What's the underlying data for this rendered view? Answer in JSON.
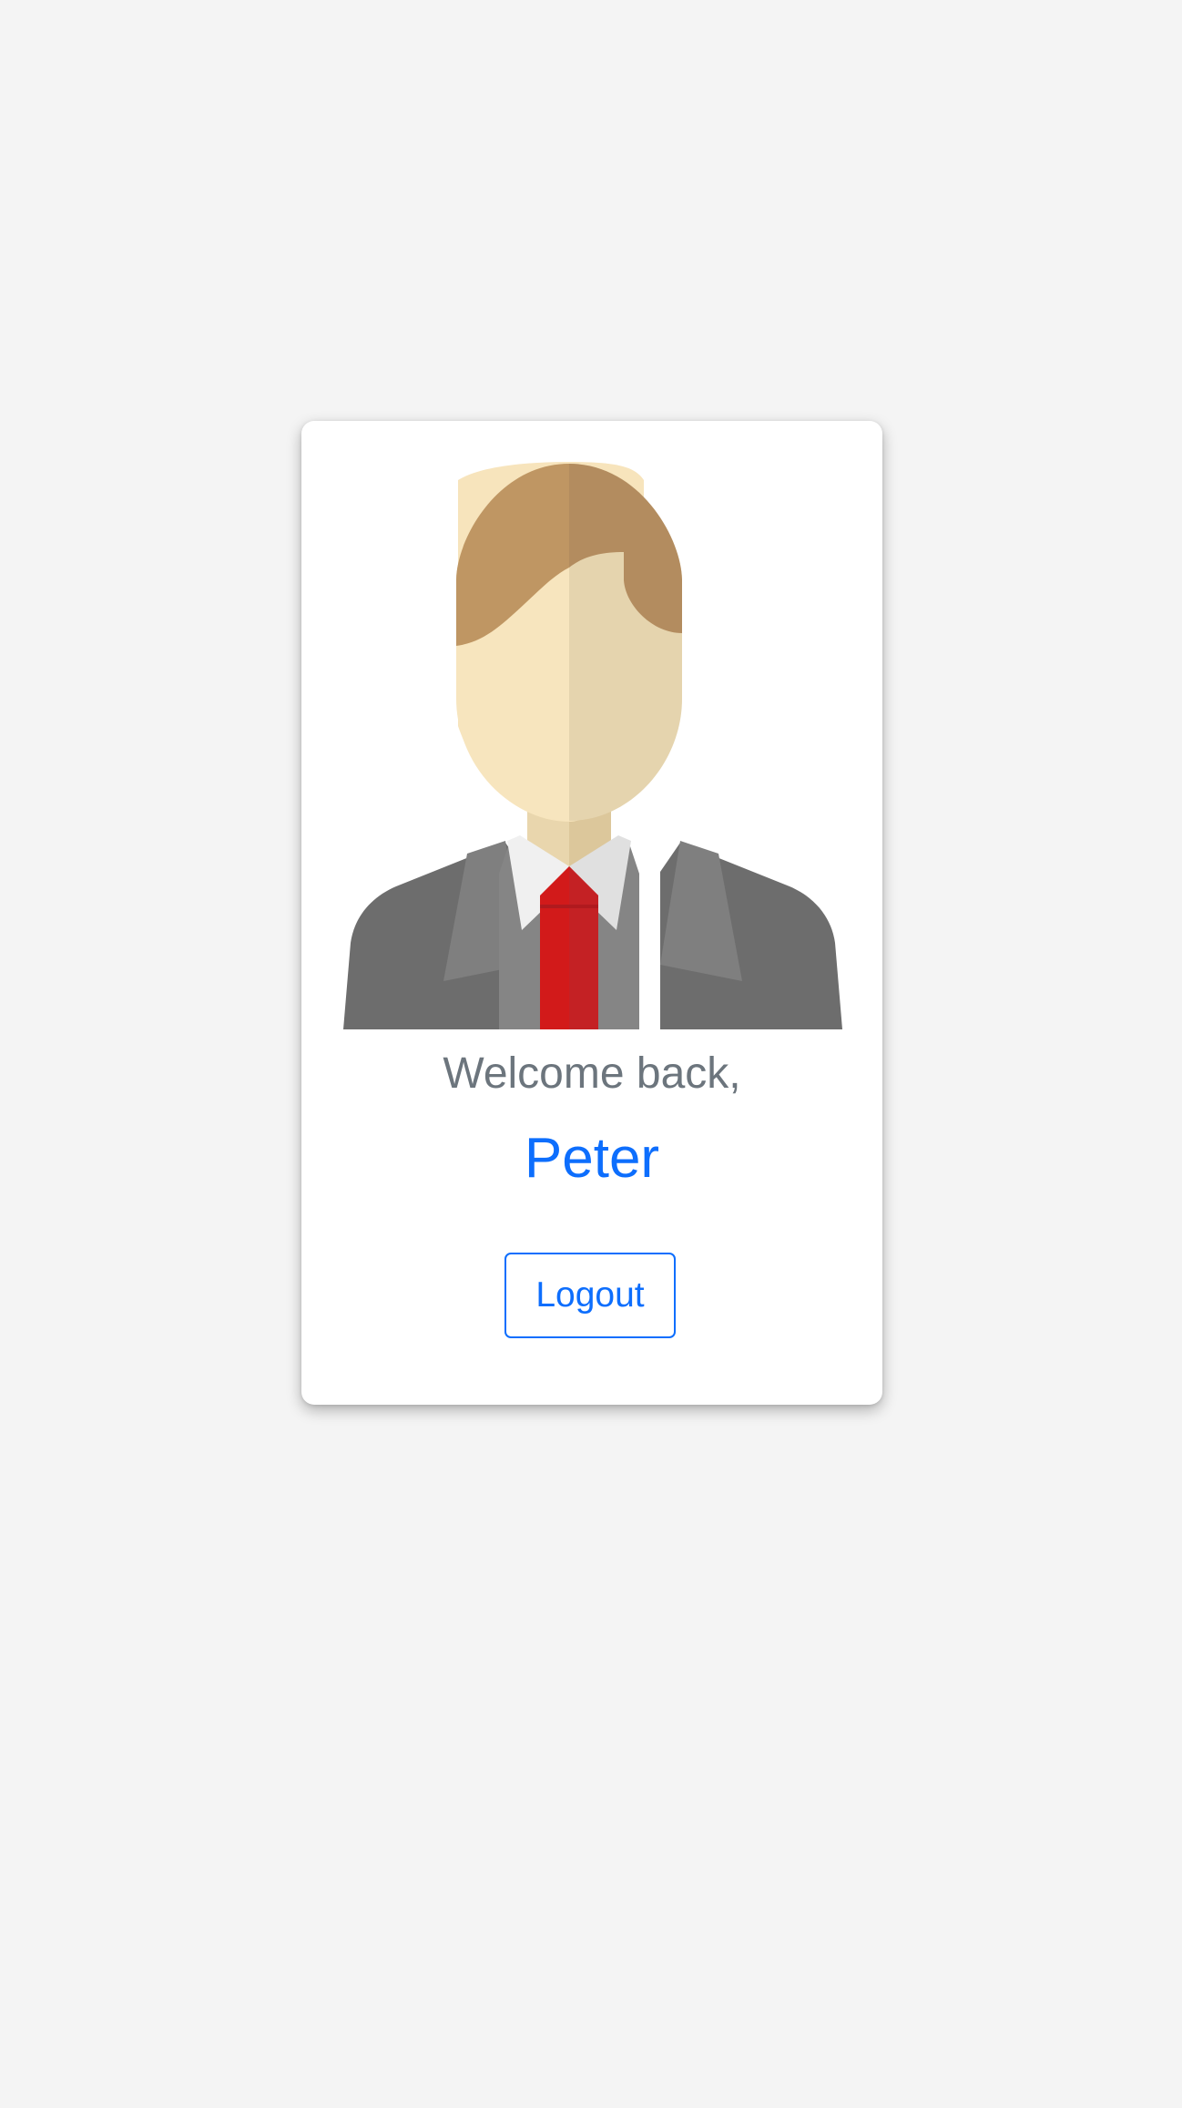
{
  "greeting": "Welcome back,",
  "user": {
    "name": "Peter"
  },
  "actions": {
    "logout_label": "Logout"
  },
  "avatar": {
    "icon": "businessman-avatar-icon"
  },
  "colors": {
    "background": "#f4f4f4",
    "card": "#ffffff",
    "accent": "#0d6efd",
    "muted_text": "#6c757d"
  }
}
